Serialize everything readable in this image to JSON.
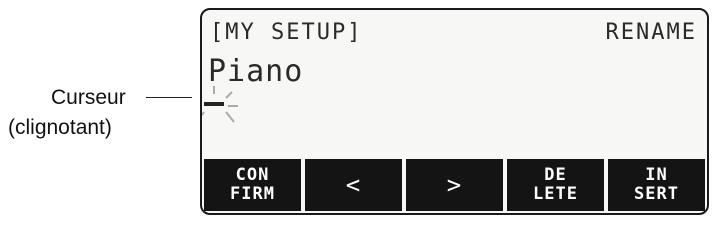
{
  "callout": {
    "line1": "Curseur",
    "line2": "(clignotant)"
  },
  "lcd": {
    "title_left": "[MY SETUP]",
    "title_right": "RENAME",
    "name_value": "Piano"
  },
  "softkeys": [
    {
      "label": "CON\nFIRM",
      "icon": ""
    },
    {
      "label": "<",
      "icon": "chevron-left"
    },
    {
      "label": ">",
      "icon": "chevron-right"
    },
    {
      "label": "DE\nLETE",
      "icon": ""
    },
    {
      "label": "IN\nSERT",
      "icon": ""
    }
  ],
  "colors": {
    "display_background": "#f7f7f5",
    "softkey_background": "#141414",
    "softkey_text": "#ffffff"
  }
}
